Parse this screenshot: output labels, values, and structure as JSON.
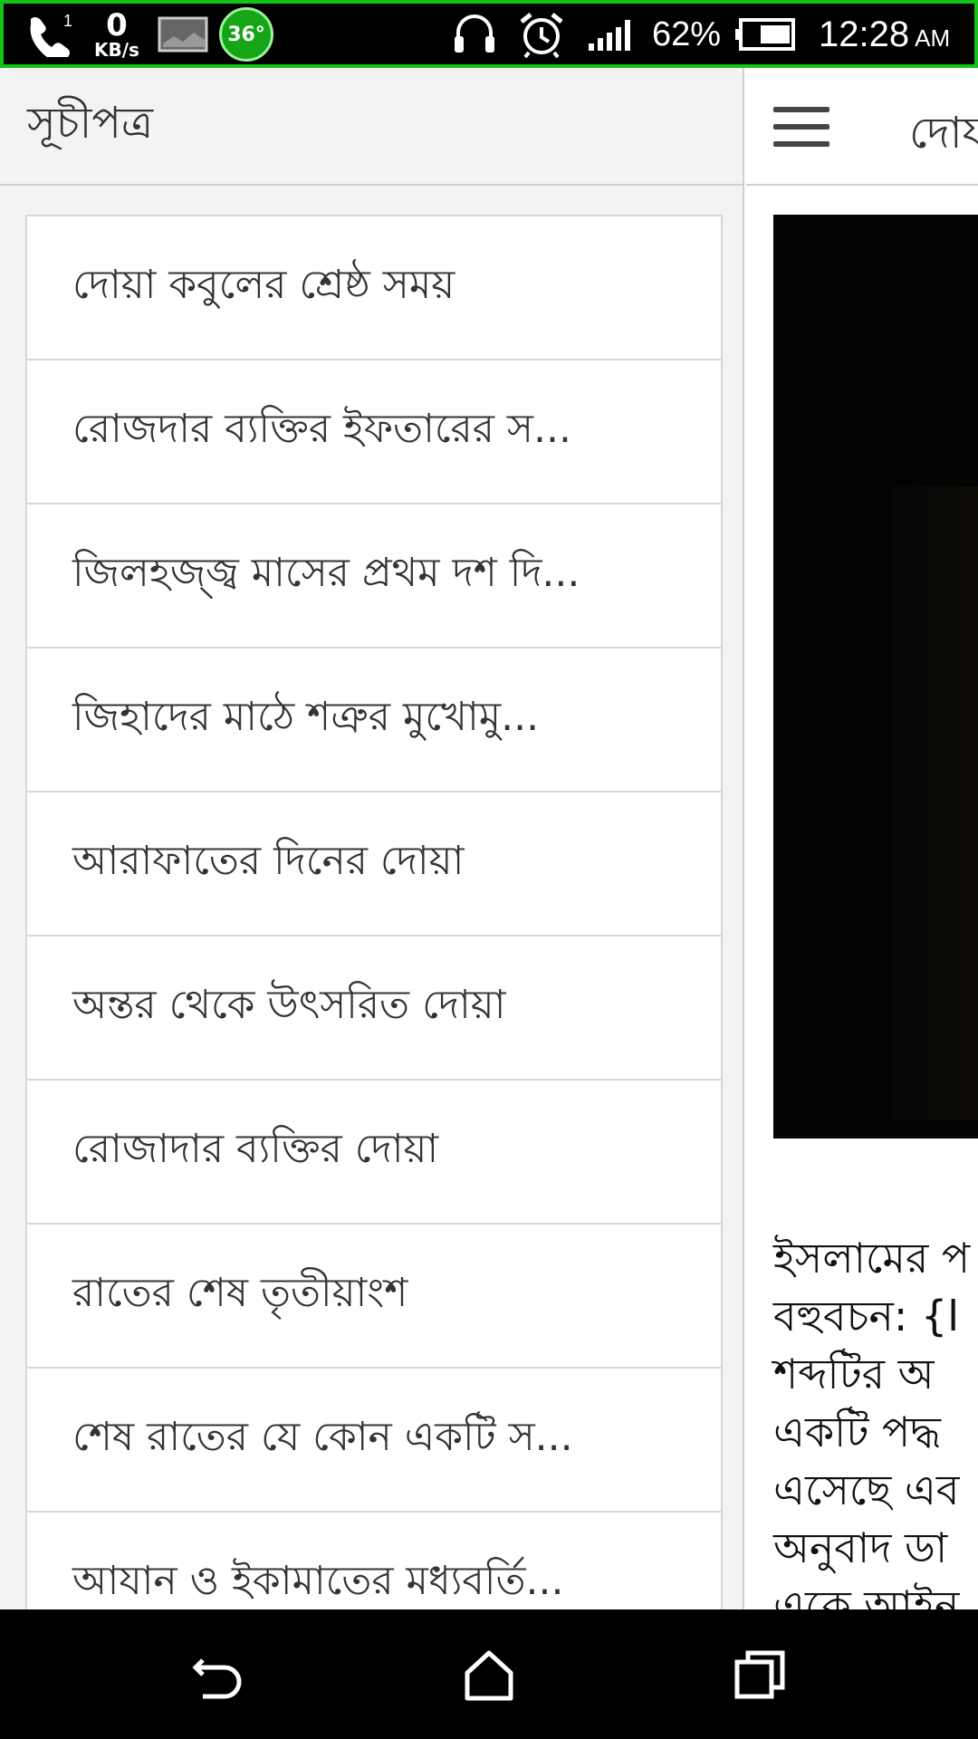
{
  "status_bar": {
    "network_speed_value": "0",
    "network_speed_unit": "KB/s",
    "notification_count": "1",
    "temperature": "36°",
    "battery_percent": "62%",
    "time": "12:28",
    "time_period": "AM",
    "accent_color": "#12c318"
  },
  "drawer": {
    "title": "সূচীপত্র",
    "items": [
      {
        "label": "দোয়া কবুলের শ্রেষ্ঠ সময়"
      },
      {
        "label": "রোজদার ব্যক্তির ইফতারের স..."
      },
      {
        "label": "জিলহজ্জ্ব মাসের প্রথম দশ দি..."
      },
      {
        "label": "জিহাদের মাঠে শত্রুর মুখোমু..."
      },
      {
        "label": "আরাফাতের দিনের দোয়া"
      },
      {
        "label": "অন্তর থেকে উৎসরিত দোয়া"
      },
      {
        "label": "রোজাদার ব্যক্তির দোয়া"
      },
      {
        "label": "রাতের শেষ তৃতীয়াংশ"
      },
      {
        "label": "শেষ রাতের যে কোন একটি স..."
      },
      {
        "label": "আযান ও ইকামাতের মধ্যবর্তি..."
      }
    ]
  },
  "main": {
    "title_partial": "দোয",
    "text_lines": [
      "ইসলামের প",
      "বহুবচন: {ا",
      "শব্দটির অ",
      "একটি পদ্ধ",
      "এসেছে এব",
      "অনুবাদ ডা",
      "একে আইন"
    ]
  },
  "icons": {
    "status": [
      "phone-icon",
      "gallery-icon",
      "headset-icon",
      "alarm-icon",
      "signal-icon",
      "battery-icon"
    ],
    "nav": [
      "back-icon",
      "home-icon",
      "recent-apps-icon"
    ]
  }
}
